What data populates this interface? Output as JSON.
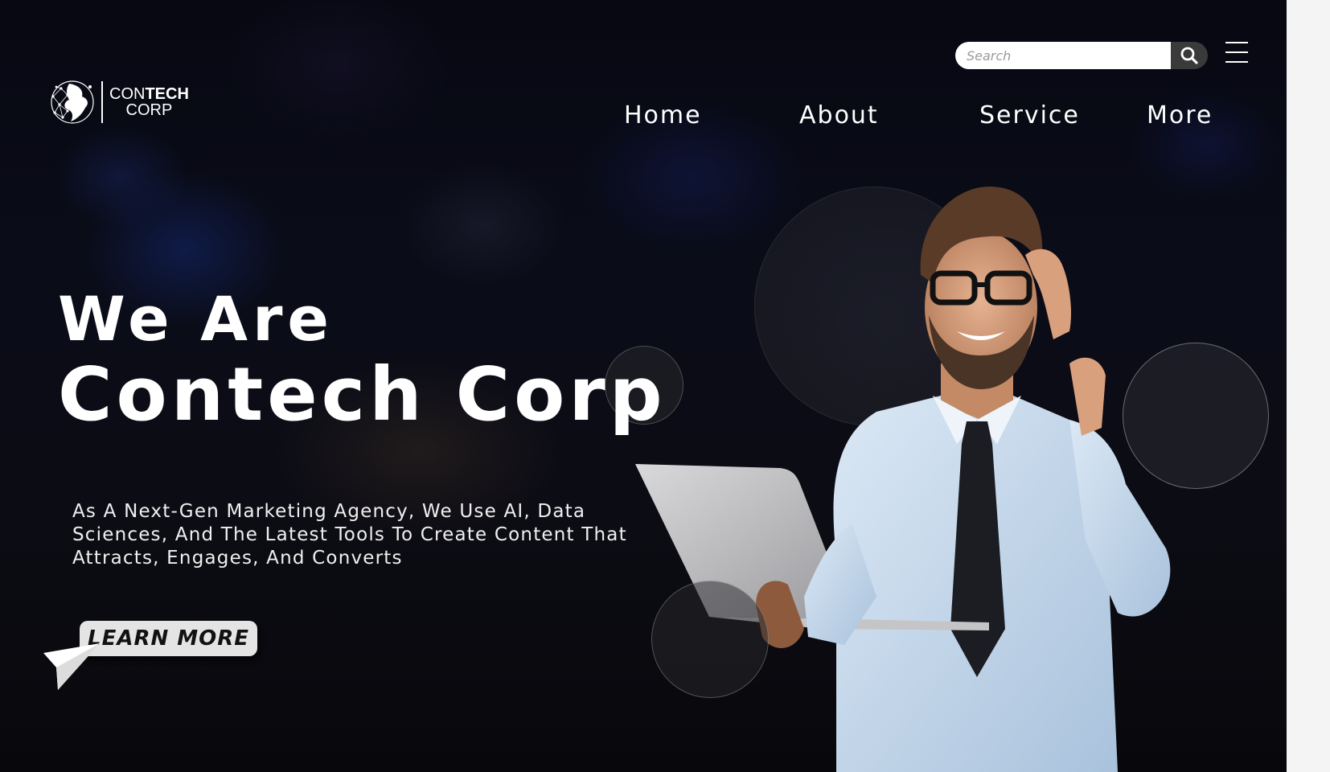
{
  "brand": {
    "logo_line1_light": "CON",
    "logo_line1_bold": "TECH",
    "logo_line2": "CORP"
  },
  "search": {
    "placeholder": "Search",
    "value": ""
  },
  "nav": {
    "items": [
      "Home",
      "About",
      "Service",
      "More"
    ]
  },
  "hero": {
    "line1": "We Are",
    "line2": "Contech Corp",
    "description": "As A Next-Gen Marketing Agency, We Use AI, Data Sciences, And The Latest Tools To Create Content That Attracts, Engages, And Converts",
    "cta_label": "LEARN MORE"
  },
  "icons": {
    "search": "search-icon",
    "menu": "hamburger-menu-icon",
    "cursor": "arrow-cursor-icon",
    "logo": "globe-network-icon"
  },
  "colors": {
    "background": "#0a0c18",
    "text": "#ffffff",
    "cta_background": "#e4e4e4",
    "search_button": "#3a3a3a",
    "shirt": "#c9dcee",
    "tie": "#1b1d22"
  }
}
